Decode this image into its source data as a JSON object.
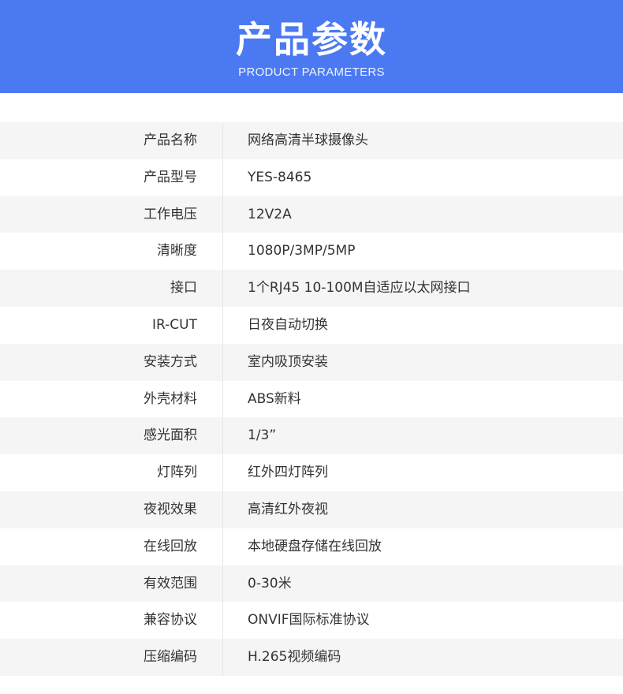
{
  "header": {
    "title": "产品参数",
    "subtitle": "PRODUCT PARAMETERS",
    "background_color": "#4b79f2"
  },
  "specs": {
    "rows": [
      {
        "label": "产品名称",
        "value": "网络高清半球摄像头"
      },
      {
        "label": "产品型号",
        "value": "YES-8465"
      },
      {
        "label": "工作电压",
        "value": "12V2A"
      },
      {
        "label": "清晰度",
        "value": "1080P/3MP/5MP"
      },
      {
        "label": "接口",
        "value": "1个RJ45 10-100M自适应以太网接口"
      },
      {
        "label": "IR-CUT",
        "value": "日夜自动切换"
      },
      {
        "label": "安装方式",
        "value": "室内吸顶安装"
      },
      {
        "label": "外壳材料",
        "value": "ABS新料"
      },
      {
        "label": "感光面积",
        "value": "1/3”"
      },
      {
        "label": "灯阵列",
        "value": "红外四灯阵列"
      },
      {
        "label": "夜视效果",
        "value": "高清红外夜视"
      },
      {
        "label": "在线回放",
        "value": "本地硬盘存储在线回放"
      },
      {
        "label": "有效范围",
        "value": "0-30米"
      },
      {
        "label": "兼容协议",
        "value": "ONVIF国际标准协议"
      },
      {
        "label": "压缩编码",
        "value": "H.265视频编码"
      }
    ]
  }
}
